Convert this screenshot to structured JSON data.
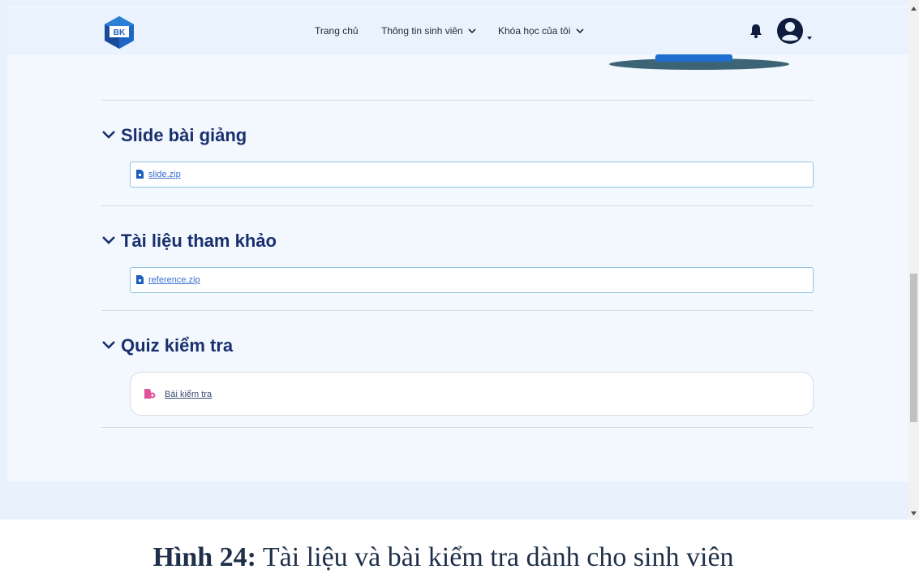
{
  "navbar": {
    "logo_text": "BK",
    "items": [
      {
        "label": "Trang chủ"
      },
      {
        "label": "Thông tin sinh viên"
      },
      {
        "label": "Khóa học của tôi"
      }
    ],
    "icons": [
      "bell-icon",
      "user-avatar-icon",
      "chevron-down-icon"
    ]
  },
  "sections": [
    {
      "title": "Slide bài giảng",
      "files": [
        {
          "name": "slide.zip",
          "icon": "file-icon"
        }
      ]
    },
    {
      "title": "Tài liệu tham khảo",
      "files": [
        {
          "name": "reference.zip",
          "icon": "file-icon"
        }
      ]
    },
    {
      "title": "Quiz kiểm tra",
      "items": [
        {
          "name": "Bài kiểm tra",
          "icon": "quiz-icon"
        }
      ]
    }
  ],
  "caption": {
    "label": "Hình 24:",
    "text": " Tài liệu và bài kiểm tra dành cho sinh viên"
  },
  "colors": {
    "navbar_bg": "#eaf2fd",
    "content_bg": "#f2f8fe",
    "title": "#1a2f6e",
    "link": "#3b6fd0",
    "file_border": "#8fc3e0",
    "quiz_icon": "#e0559a",
    "brand_blue": "#1f5fbf"
  }
}
